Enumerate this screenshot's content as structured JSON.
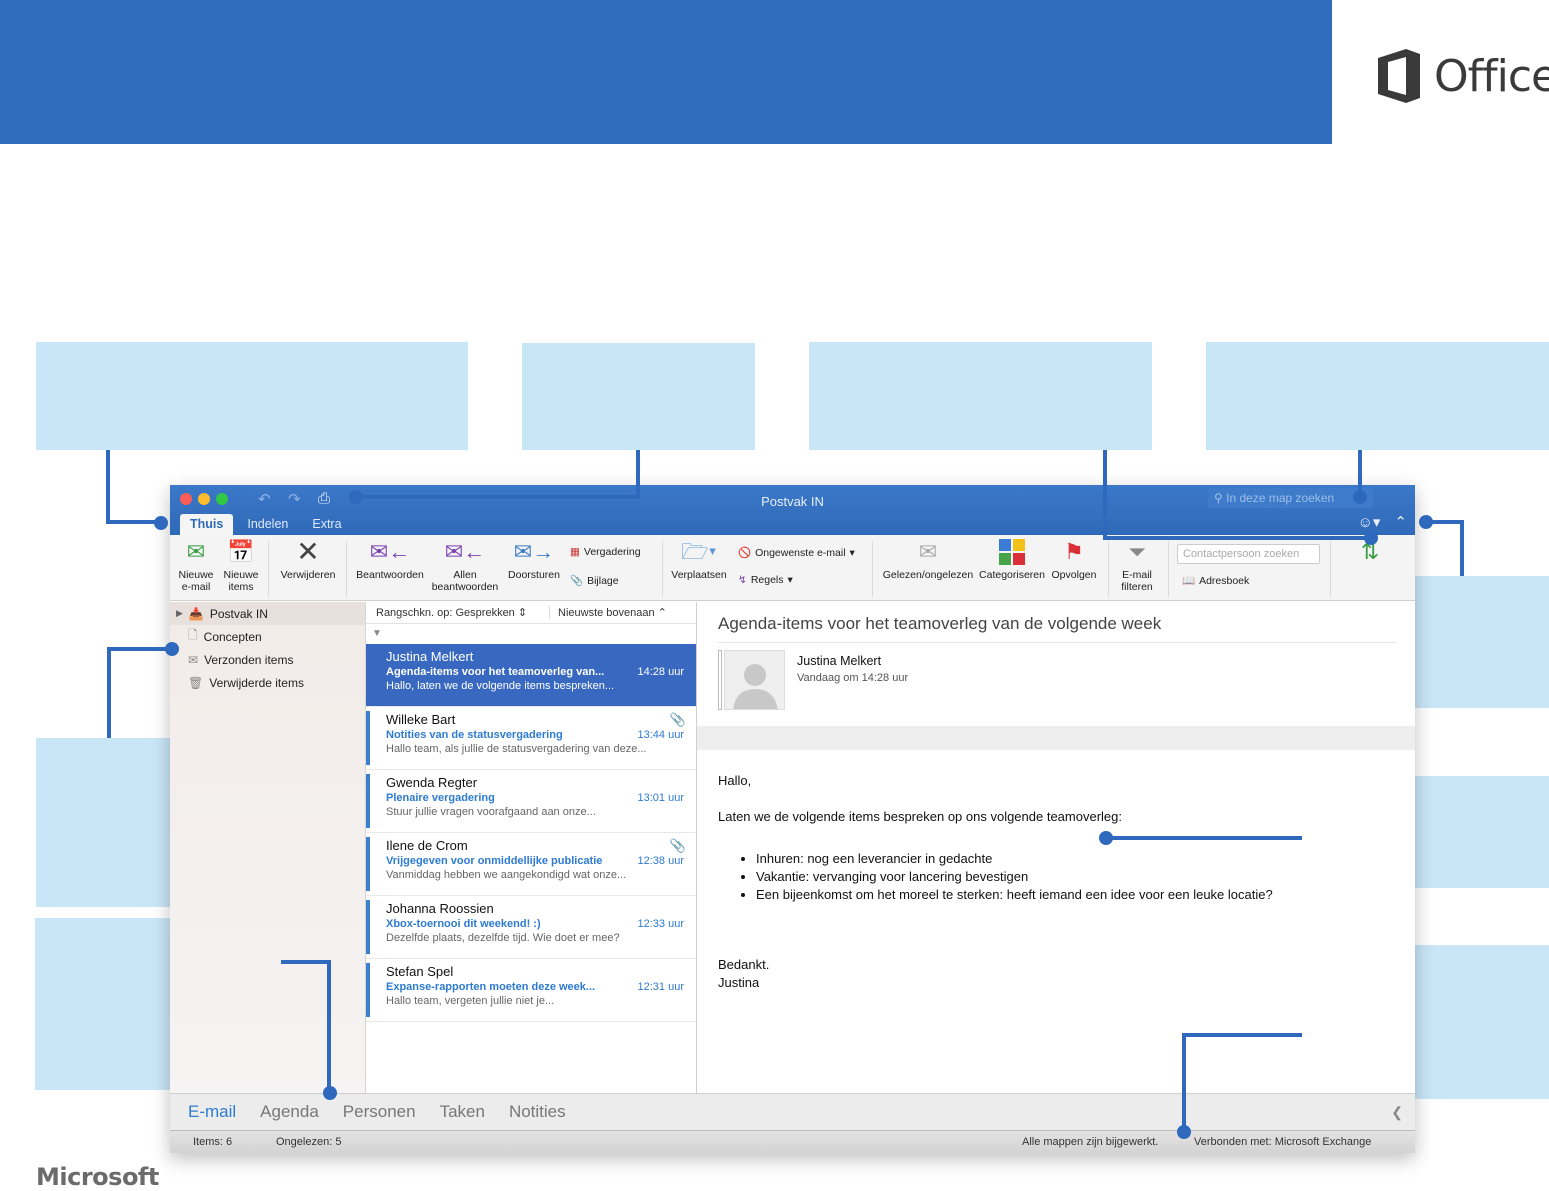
{
  "brand": {
    "office": "Office",
    "microsoft": "Microsoft",
    "banner_color": "#306cbd",
    "callout_color": "#c9e6f7",
    "connector_color": "#2f69bd"
  },
  "window": {
    "title": "Postvak IN",
    "search_placeholder": "In deze map zoeken",
    "tabs": [
      {
        "label": "Thuis",
        "active": true
      },
      {
        "label": "Indelen"
      },
      {
        "label": "Extra"
      }
    ],
    "toolbar_icons": [
      "undo-icon",
      "redo-icon",
      "print-icon"
    ]
  },
  "ribbon": {
    "new_email": "Nieuwe\ne-mail",
    "new_items": "Nieuwe\nitems",
    "delete": "Verwijderen",
    "reply": "Beantwoorden",
    "reply_all": "Allen\nbeantwoorden",
    "forward": "Doorsturen",
    "meeting": "Vergadering",
    "attachment": "Bijlage",
    "move": "Verplaatsen",
    "junk": "Ongewenste e-mail",
    "rules": "Regels",
    "read_unread": "Gelezen/ongelezen",
    "categorize": "Categoriseren",
    "follow_up": "Opvolgen",
    "filter": "E-mail\nfilteren",
    "contact_search_placeholder": "Contactpersoon zoeken",
    "address_book": "Adresboek"
  },
  "folders": [
    {
      "label": "Postvak IN",
      "selected": true
    },
    {
      "label": "Concepten"
    },
    {
      "label": "Verzonden items"
    },
    {
      "label": "Verwijderde items"
    }
  ],
  "list": {
    "sort_by": "Rangschkn. op: Gesprekken",
    "order": "Nieuwste bovenaan",
    "messages": [
      {
        "from": "Justina Melkert",
        "subject": "Agenda-items voor het teamoverleg van...",
        "time": "14:28 uur",
        "preview": "Hallo, laten we de volgende items bespreken...",
        "selected": true,
        "attachment": false
      },
      {
        "from": "Willeke Bart",
        "subject": "Notities van de statusvergadering",
        "time": "13:44 uur",
        "preview": "Hallo team, als jullie de statusvergadering van deze...",
        "attachment": true
      },
      {
        "from": "Gwenda Regter",
        "subject": "Plenaire vergadering",
        "time": "13:01 uur",
        "preview": "Stuur jullie vragen voorafgaand aan onze...",
        "attachment": false
      },
      {
        "from": "Ilene de Crom",
        "subject": "Vrijgegeven voor onmiddellijke publicatie",
        "time": "12:38 uur",
        "preview": "Vanmiddag hebben we aangekondigd wat onze...",
        "attachment": true
      },
      {
        "from": "Johanna Roossien",
        "subject": "Xbox-toernooi dit weekend! :)",
        "time": "12:33 uur",
        "preview": "Dezelfde plaats, dezelfde tijd. Wie doet er mee?",
        "attachment": false
      },
      {
        "from": "Stefan Spel",
        "subject": "Expanse-rapporten moeten deze week...",
        "time": "12:31 uur",
        "preview": "Hallo team, vergeten jullie niet je...",
        "attachment": false
      }
    ]
  },
  "reading": {
    "subject": "Agenda-items voor het teamoverleg van de volgende week",
    "sender": "Justina Melkert",
    "when": "Vandaag om 14:28 uur",
    "greeting": "Hallo,",
    "intro": "Laten we de volgende items bespreken op ons volgende teamoverleg:",
    "bullets": [
      "Inhuren: nog een leverancier in gedachte",
      "Vakantie: vervanging voor lancering bevestigen",
      "Een bijeenkomst om het moreel te sterken: heeft iemand een idee voor een leuke locatie?"
    ],
    "closing": "Bedankt.",
    "signature": "Justina"
  },
  "nav": [
    {
      "label": "E-mail",
      "active": true
    },
    {
      "label": "Agenda"
    },
    {
      "label": "Personen"
    },
    {
      "label": "Taken"
    },
    {
      "label": "Notities"
    }
  ],
  "status": {
    "items": "Items: 6",
    "unread": "Ongelezen: 5",
    "sync": "Alle mappen zijn bijgewerkt.",
    "connection": "Verbonden met: Microsoft Exchange"
  }
}
